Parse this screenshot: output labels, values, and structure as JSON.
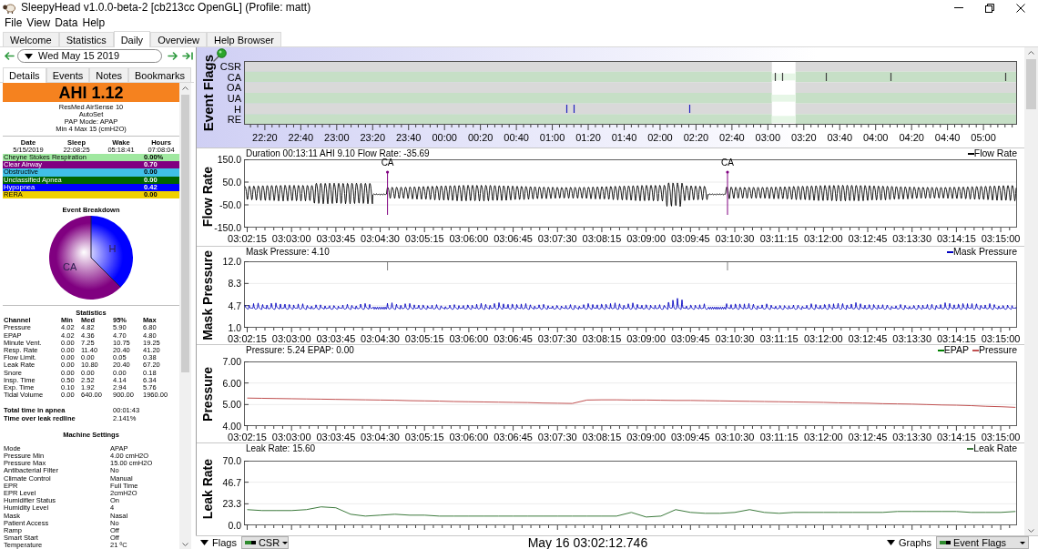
{
  "window": {
    "title": "SleepyHead v1.0.0-beta-2 [cb213cc OpenGL] (Profile: matt)"
  },
  "menu": [
    "File",
    "View",
    "Data",
    "Help"
  ],
  "tabs": [
    {
      "label": "Welcome",
      "selected": false
    },
    {
      "label": "Statistics",
      "selected": false
    },
    {
      "label": "Daily",
      "selected": true
    },
    {
      "label": "Overview",
      "selected": false
    },
    {
      "label": "Help Browser",
      "selected": false
    }
  ],
  "date_nav": {
    "date": "Wed May 15 2019"
  },
  "detail_tabs": [
    {
      "label": "Details",
      "selected": true
    },
    {
      "label": "Events",
      "selected": false
    },
    {
      "label": "Notes",
      "selected": false
    },
    {
      "label": "Bookmarks",
      "selected": false
    }
  ],
  "summary": {
    "ahi": "AHI 1.12",
    "device": [
      "ResMed AirSense 10",
      "AutoSet",
      "PAP Mode: APAP",
      "Min 4 Max 15 (cmH2O)"
    ],
    "columns": [
      "Date",
      "Sleep",
      "Wake",
      "Hours"
    ],
    "values": [
      "5/15/2019",
      "22:08:25",
      "05:18:41",
      "07:08:04"
    ]
  },
  "event_indices": [
    {
      "name": "Cheyne Stokes Respiration",
      "value": "0.00%",
      "color": "#a0e8a0"
    },
    {
      "name": "Clear Airway",
      "value": "0.70",
      "color": "#800080"
    },
    {
      "name": "Obstructive",
      "value": "0.00",
      "color": "#40c0e8"
    },
    {
      "name": "Unclassified Apnea",
      "value": "0.00",
      "color": "#006400"
    },
    {
      "name": "Hypopnea",
      "value": "0.42",
      "color": "#0000ff"
    },
    {
      "name": "RERA",
      "value": "0.00",
      "color": "#f0d000"
    }
  ],
  "breakdown": {
    "title": "Event Breakdown",
    "slices": [
      {
        "label": "CA",
        "color": "#800080"
      },
      {
        "label": "H",
        "color": "#0000ff"
      }
    ]
  },
  "statistics": {
    "title": "Statistics",
    "columns": [
      "Channel",
      "Min",
      "Med",
      "95%",
      "Max"
    ],
    "rows": [
      [
        "Pressure",
        "4.02",
        "4.82",
        "5.90",
        "6.80"
      ],
      [
        "EPAP",
        "4.02",
        "4.36",
        "4.70",
        "4.80"
      ],
      [
        "Minute Vent.",
        "0.00",
        "7.25",
        "10.75",
        "19.25"
      ],
      [
        "Resp. Rate",
        "0.00",
        "11.40",
        "20.40",
        "41.20"
      ],
      [
        "Flow Limit.",
        "0.00",
        "0.00",
        "0.05",
        "0.38"
      ],
      [
        "Leak Rate",
        "0.00",
        "10.80",
        "20.40",
        "67.20"
      ],
      [
        "Snore",
        "0.00",
        "0.00",
        "0.00",
        "0.18"
      ],
      [
        "Insp. Time",
        "0.50",
        "2.52",
        "4.14",
        "6.34"
      ],
      [
        "Exp. Time",
        "0.10",
        "1.92",
        "2.94",
        "5.76"
      ],
      [
        "Tidal Volume",
        "0.00",
        "640.00",
        "900.00",
        "1960.00"
      ]
    ]
  },
  "totals": [
    {
      "label": "Total time in apnea",
      "value": "00:01:43"
    },
    {
      "label": "Time over leak redline",
      "value": "2.141%"
    }
  ],
  "machine_settings": {
    "title": "Machine Settings",
    "rows": [
      [
        "Mode",
        "APAP"
      ],
      [
        "Pressure Min",
        "4.00 cmH2O"
      ],
      [
        "Pressure Max",
        "15.00 cmH2O"
      ],
      [
        "Antibacterial Filter",
        "No"
      ],
      [
        "Climate Control",
        "Manual"
      ],
      [
        "EPR",
        "Full Time"
      ],
      [
        "EPR Level",
        "2cmH2O"
      ],
      [
        "Humidifier Status",
        "On"
      ],
      [
        "Humidity Level",
        "4"
      ],
      [
        "Mask",
        "Nasal"
      ],
      [
        "Patient Access",
        "No"
      ],
      [
        "Ramp",
        "Off"
      ],
      [
        "Smart Start",
        "Off"
      ],
      [
        "Temperature",
        "21 ºC"
      ]
    ]
  },
  "event_flags": {
    "label": "Event Flags",
    "rows": [
      "CSR",
      "CA",
      "OA",
      "UA",
      "H",
      "RE"
    ],
    "time_labels": [
      "22:20",
      "22:40",
      "23:00",
      "23:20",
      "23:40",
      "00:00",
      "00:20",
      "00:40",
      "01:00",
      "01:20",
      "01:40",
      "02:00",
      "02:20",
      "02:40",
      "03:00",
      "03:20",
      "03:40",
      "04:00",
      "04:20",
      "04:40",
      "05:00"
    ]
  },
  "graphs": [
    {
      "kind": "flow",
      "label": "Flow Rate",
      "header": "Duration 00:13:11 AHI 9.10 Flow Rate: -35.69",
      "legend": [
        {
          "label": "Flow Rate",
          "color": "#000000"
        }
      ],
      "yticks": [
        "150.0",
        "50.0",
        "-50.0",
        "-150.0"
      ],
      "xticks": [
        "03:02:15",
        "03:03:00",
        "03:03:45",
        "03:04:30",
        "03:05:15",
        "03:06:00",
        "03:06:45",
        "03:07:30",
        "03:08:15",
        "03:09:00",
        "03:09:45",
        "03:10:30",
        "03:11:15",
        "03:12:00",
        "03:12:45",
        "03:13:30",
        "03:14:15",
        "03:15:00"
      ],
      "flags": [
        {
          "label": "CA"
        },
        {
          "label": "CA"
        }
      ]
    },
    {
      "kind": "mask",
      "label": "Mask Pressure",
      "header": "Mask Pressure: 4.10",
      "legend": [
        {
          "label": "Mask Pressure",
          "color": "#0000c0"
        }
      ],
      "yticks": [
        "12.0",
        "8.3",
        "4.7",
        "1.0"
      ],
      "xticks": [
        "03:02:15",
        "03:03:00",
        "03:03:45",
        "03:04:30",
        "03:05:15",
        "03:06:00",
        "03:06:45",
        "03:07:30",
        "03:08:15",
        "03:09:00",
        "03:09:45",
        "03:10:30",
        "03:11:15",
        "03:12:00",
        "03:12:45",
        "03:13:30",
        "03:14:15",
        "03:15:00"
      ]
    },
    {
      "kind": "line",
      "label": "Pressure",
      "header": "Pressure: 5.24 EPAP: 0.00",
      "chart_data": {
        "type": "line",
        "categories": [
          "03:02:15",
          null,
          null,
          "03:03:00",
          null,
          null,
          "03:03:45",
          null,
          null,
          "03:04:30",
          null,
          null,
          "03:05:15",
          null,
          null,
          "03:06:00",
          null,
          null,
          "03:06:45",
          null,
          null,
          "03:07:30",
          null,
          null,
          "03:08:15",
          null,
          null,
          "03:09:00",
          null,
          null,
          "03:09:45",
          null,
          null,
          "03:10:30",
          null,
          null,
          "03:11:15",
          null,
          null,
          "03:12:00",
          null,
          null,
          "03:12:45",
          null,
          null,
          "03:13:30",
          null,
          null,
          "03:14:15",
          null,
          null,
          "03:15:00",
          null
        ],
        "series": [
          {
            "name": "EPAP",
            "color": "#008000",
            "values": [
              null,
              null,
              null,
              null,
              null,
              null,
              null,
              null,
              null,
              null,
              null,
              null,
              null,
              null,
              null,
              null,
              null,
              null,
              null,
              null,
              null,
              null,
              null,
              null,
              null,
              null,
              null,
              null,
              null,
              null,
              null,
              null,
              null,
              null,
              null,
              null,
              null,
              null,
              null,
              null,
              null,
              null,
              null,
              null,
              null,
              null,
              null,
              null,
              null,
              null,
              null,
              null,
              null
            ]
          },
          {
            "name": "Pressure",
            "color": "#c05050",
            "values": [
              5.3,
              5.29,
              5.28,
              5.27,
              5.26,
              5.25,
              5.24,
              5.23,
              5.22,
              5.21,
              5.2,
              5.18,
              5.17,
              5.16,
              5.14,
              5.13,
              5.12,
              5.11,
              5.1,
              5.09,
              5.07,
              5.06,
              5.05,
              5.21,
              5.22,
              5.22,
              5.21,
              5.21,
              5.2,
              5.19,
              5.19,
              5.18,
              5.17,
              5.16,
              5.15,
              5.14,
              5.13,
              5.12,
              5.11,
              5.1,
              5.08,
              5.07,
              5.06,
              5.04,
              5.03,
              5.02,
              5.0,
              4.98,
              4.97,
              4.95,
              4.92,
              4.9,
              4.87
            ]
          }
        ],
        "ylim": [
          4,
          7
        ],
        "yticks": [
          {
            "value": 7,
            "label": "7.00"
          },
          {
            "value": 6,
            "label": "6.00"
          },
          {
            "value": 5,
            "label": "5.00"
          },
          {
            "value": 4,
            "label": "4.00"
          }
        ]
      }
    },
    {
      "kind": "line",
      "label": "Leak Rate",
      "header": "Leak Rate: 15.60",
      "chart_data": {
        "type": "line",
        "categories": [
          null,
          null,
          null,
          null,
          null,
          null,
          null,
          null,
          null,
          null,
          null,
          null,
          null,
          null,
          null,
          null,
          null,
          null,
          null,
          null,
          null,
          null,
          null,
          null,
          null,
          null,
          null,
          null,
          null,
          null,
          null,
          null,
          null,
          null,
          null,
          null,
          null,
          null,
          null,
          null,
          null,
          null,
          null,
          null,
          null,
          null,
          null,
          null,
          null,
          null,
          null,
          null,
          null
        ],
        "series": [
          {
            "name": "Leak Rate",
            "color": "#3c7a3c",
            "values": [
              17,
              16,
              16,
              16,
              17,
              20,
              19,
              12,
              10,
              11,
              12,
              11,
              11,
              10,
              10,
              10,
              10,
              10,
              10,
              10,
              10,
              10,
              10,
              10,
              10,
              10,
              14,
              9,
              10,
              17,
              14,
              13,
              13,
              14,
              17,
              14,
              13,
              14,
              14,
              14,
              14,
              14,
              14,
              14,
              15,
              15,
              15,
              15,
              15,
              14,
              14,
              14,
              15
            ]
          }
        ],
        "ylim": [
          0,
          70
        ],
        "yticks": [
          {
            "value": 70,
            "label": "70.0"
          },
          {
            "value": 46.7,
            "label": "46.7"
          },
          {
            "value": 23.3,
            "label": "23.3"
          },
          {
            "value": 0,
            "label": "0.0"
          }
        ]
      }
    }
  ],
  "bottom_bar": {
    "flags_button": "Flags",
    "flag_combo": "CSR",
    "time": "May 16 03:02:12.746",
    "graphs_button": "Graphs",
    "graph_combo": "Event Flags"
  }
}
